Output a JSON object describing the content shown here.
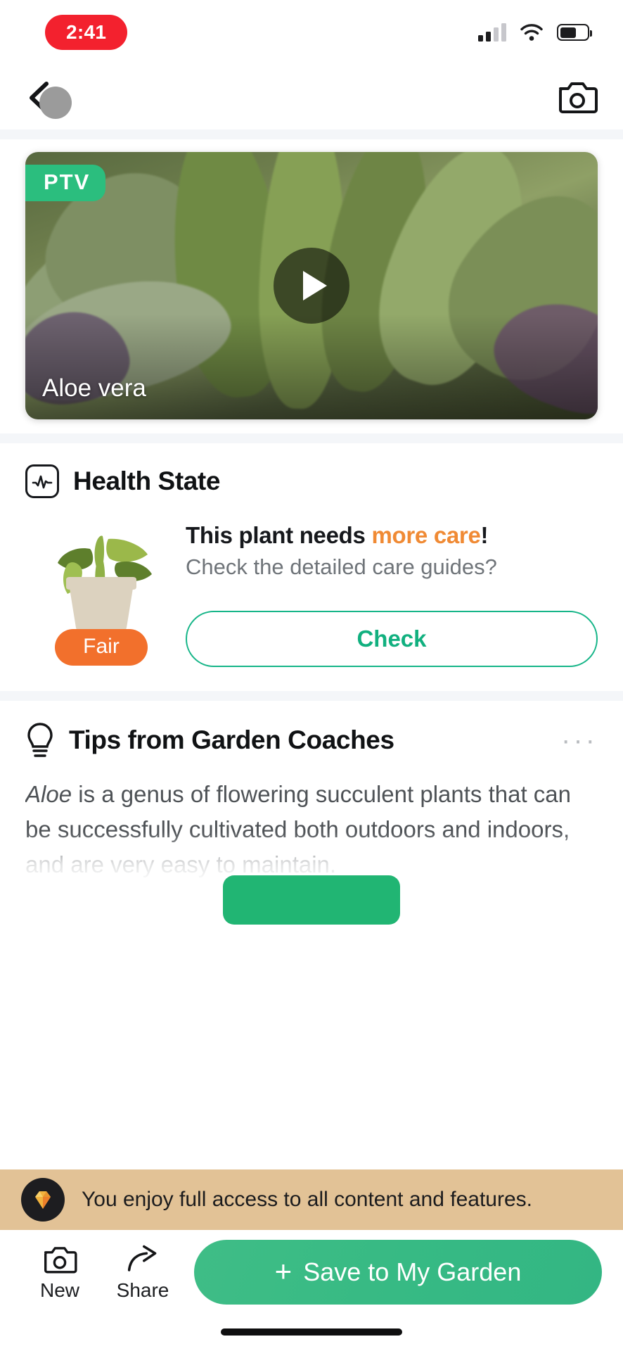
{
  "status_bar": {
    "recording_time": "2:41",
    "icons": [
      "cellular-signal-icon",
      "wifi-icon",
      "battery-icon"
    ]
  },
  "nav_bar": {
    "back_icon": "chevron-left-icon",
    "camera_icon": "camera-icon"
  },
  "video_card": {
    "badge": "PTV",
    "title": "Aloe vera",
    "play_icon": "play-icon"
  },
  "health_state": {
    "icon": "pulse-icon",
    "title": "Health State",
    "rating_badge": "Fair",
    "message_prefix": "This plant needs ",
    "message_highlight": "more care",
    "message_suffix": "!",
    "subtitle": "Check the detailed care guides?",
    "check_button": "Check",
    "colors": {
      "highlight": "#F08A34",
      "badge": "#F2702C",
      "button_border": "#16B588",
      "button_text": "#11B07F"
    }
  },
  "tips": {
    "icon": "lightbulb-icon",
    "title": "Tips from Garden Coaches",
    "more_icon": "ellipsis-icon",
    "body_italic": "Aloe",
    "body_text": " is a genus of flowering succulent plants that can be successfully cultivated both outdoors and indoors, and are very easy to maintain."
  },
  "promo_banner": {
    "icon": "gem-icon",
    "text": "You enjoy full access to all content and features.",
    "background": "#E2C296"
  },
  "bottom_bar": {
    "tools": [
      {
        "icon": "camera-icon",
        "label": "New"
      },
      {
        "icon": "share-icon",
        "label": "Share"
      }
    ],
    "primary_button": {
      "plus": "+",
      "label": "Save to My Garden",
      "color": "#37BA84"
    }
  }
}
